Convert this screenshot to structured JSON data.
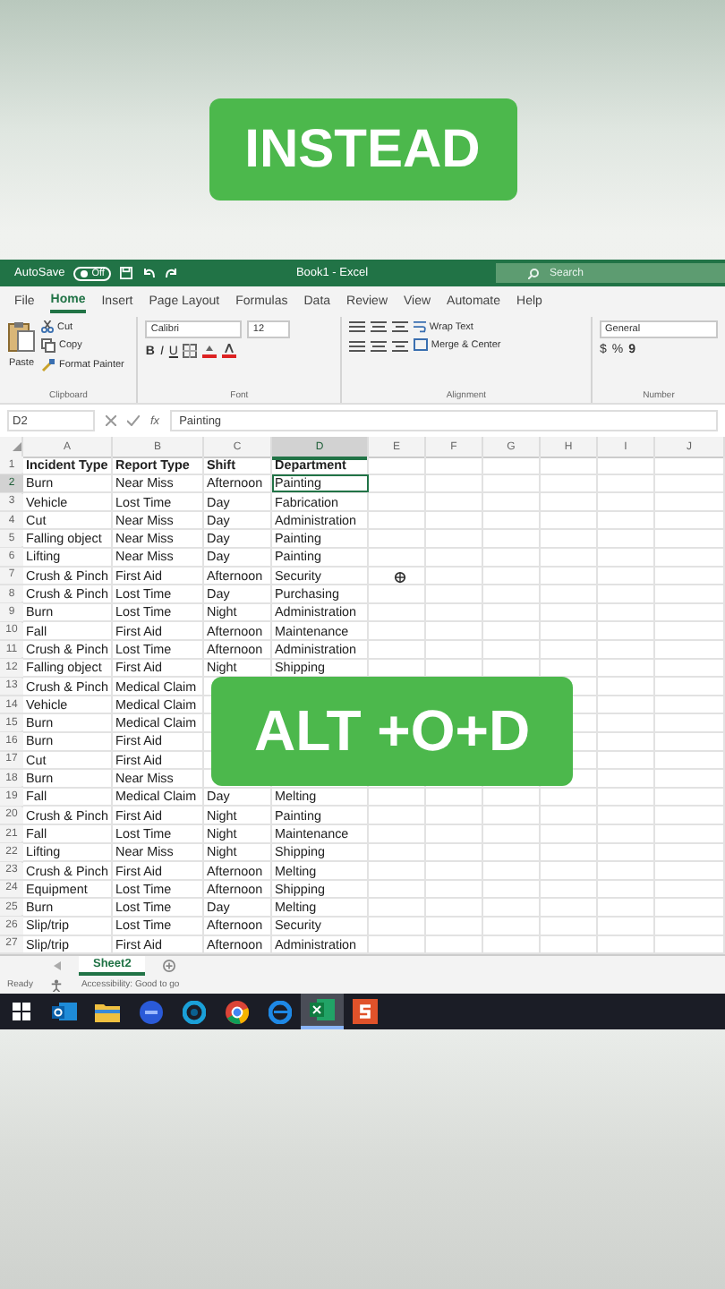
{
  "captions": [
    {
      "text": "INSTEAD"
    },
    {
      "text": "ALT +O+D"
    }
  ],
  "title_bar": {
    "autosave_label": "AutoSave",
    "autosave": {
      "label": "Off",
      "on": false
    },
    "title": "Book1 - Excel",
    "search": {
      "placeholder": "Search"
    }
  },
  "tabs": [
    {
      "label": "File",
      "selected": false
    },
    {
      "label": "Home",
      "selected": true
    },
    {
      "label": "Insert",
      "selected": false
    },
    {
      "label": "Page Layout",
      "selected": false
    },
    {
      "label": "Formulas",
      "selected": false
    },
    {
      "label": "Data",
      "selected": false
    },
    {
      "label": "Review",
      "selected": false
    },
    {
      "label": "View",
      "selected": false
    },
    {
      "label": "Automate",
      "selected": false
    },
    {
      "label": "Help",
      "selected": false
    }
  ],
  "ribbon": {
    "clipboard": {
      "paste": "Paste",
      "cut": "Cut",
      "copy": "Copy",
      "format_painter": "Format Painter",
      "label": "Clipboard"
    },
    "font": {
      "name": "Calibri",
      "size": "12",
      "bold": "B",
      "italic": "I",
      "underline": "U",
      "label": "Font"
    },
    "alignment": {
      "wrap": "Wrap Text",
      "merge": "Merge & Center",
      "label": "Alignment"
    },
    "number": {
      "format": "General",
      "currency": "$",
      "percent": "%",
      "comma": "9",
      "label": "Number"
    }
  },
  "formula_bar": {
    "name_box": "D2",
    "fx": "fx",
    "formula": "Painting"
  },
  "columns": [
    {
      "label": "A",
      "selected": false
    },
    {
      "label": "B",
      "selected": false
    },
    {
      "label": "C",
      "selected": false
    },
    {
      "label": "D",
      "selected": true
    },
    {
      "label": "E",
      "selected": false
    },
    {
      "label": "F",
      "selected": false
    },
    {
      "label": "G",
      "selected": false
    },
    {
      "label": "H",
      "selected": false
    },
    {
      "label": "I",
      "selected": false
    },
    {
      "label": "J",
      "selected": false
    }
  ],
  "rows": [
    {
      "num": "1",
      "kind": "header",
      "selected": false,
      "cells": [
        "Incident Type",
        "Report Type",
        "Shift",
        "Department"
      ]
    },
    {
      "num": "2",
      "kind": "data",
      "selected": true,
      "cells": [
        "Burn",
        "Near Miss",
        "Afternoon",
        "Painting"
      ]
    },
    {
      "num": "3",
      "kind": "data",
      "selected": false,
      "cells": [
        "Vehicle",
        "Lost Time",
        "Day",
        "Fabrication"
      ]
    },
    {
      "num": "4",
      "kind": "data",
      "selected": false,
      "cells": [
        "Cut",
        "Near Miss",
        "Day",
        "Administration"
      ]
    },
    {
      "num": "5",
      "kind": "data",
      "selected": false,
      "cells": [
        "Falling object",
        "Near Miss",
        "Day",
        "Painting"
      ]
    },
    {
      "num": "6",
      "kind": "data",
      "selected": false,
      "cells": [
        "Lifting",
        "Near Miss",
        "Day",
        "Painting"
      ]
    },
    {
      "num": "7",
      "kind": "data",
      "selected": false,
      "cells": [
        "Crush & Pinch",
        "First Aid",
        "Afternoon",
        "Security"
      ]
    },
    {
      "num": "8",
      "kind": "data",
      "selected": false,
      "cells": [
        "Crush & Pinch",
        "Lost Time",
        "Day",
        "Purchasing"
      ]
    },
    {
      "num": "9",
      "kind": "data",
      "selected": false,
      "cells": [
        "Burn",
        "Lost Time",
        "Night",
        "Administration"
      ]
    },
    {
      "num": "10",
      "kind": "data",
      "selected": false,
      "cells": [
        "Fall",
        "First Aid",
        "Afternoon",
        "Maintenance"
      ]
    },
    {
      "num": "11",
      "kind": "data",
      "selected": false,
      "cells": [
        "Crush & Pinch",
        "Lost Time",
        "Afternoon",
        "Administration"
      ]
    },
    {
      "num": "12",
      "kind": "data",
      "selected": false,
      "cells": [
        "Falling object",
        "First Aid",
        "Night",
        "Shipping"
      ]
    },
    {
      "num": "13",
      "kind": "data",
      "selected": false,
      "cells": [
        "Crush & Pinch",
        "Medical Claim"
      ]
    },
    {
      "num": "14",
      "kind": "data",
      "selected": false,
      "cells": [
        "Vehicle",
        "Medical Claim"
      ]
    },
    {
      "num": "15",
      "kind": "data",
      "selected": false,
      "cells": [
        "Burn",
        "Medical Claim"
      ]
    },
    {
      "num": "16",
      "kind": "data",
      "selected": false,
      "cells": [
        "Burn",
        "First Aid"
      ]
    },
    {
      "num": "17",
      "kind": "data",
      "selected": false,
      "cells": [
        "Cut",
        "First Aid"
      ]
    },
    {
      "num": "18",
      "kind": "data",
      "selected": false,
      "cells": [
        "Burn",
        "Near Miss"
      ]
    },
    {
      "num": "19",
      "kind": "data",
      "selected": false,
      "cells": [
        "Fall",
        "Medical Claim",
        "Day",
        "Melting"
      ]
    },
    {
      "num": "20",
      "kind": "data",
      "selected": false,
      "cells": [
        "Crush & Pinch",
        "First Aid",
        "Night",
        "Painting"
      ]
    },
    {
      "num": "21",
      "kind": "data",
      "selected": false,
      "cells": [
        "Fall",
        "Lost Time",
        "Night",
        "Maintenance"
      ]
    },
    {
      "num": "22",
      "kind": "data",
      "selected": false,
      "cells": [
        "Lifting",
        "Near Miss",
        "Night",
        "Shipping"
      ]
    },
    {
      "num": "23",
      "kind": "data",
      "selected": false,
      "cells": [
        "Crush & Pinch",
        "First Aid",
        "Afternoon",
        "Melting"
      ]
    },
    {
      "num": "24",
      "kind": "data",
      "selected": false,
      "cells": [
        "Equipment",
        "Lost Time",
        "Afternoon",
        "Shipping"
      ]
    },
    {
      "num": "25",
      "kind": "data",
      "selected": false,
      "cells": [
        "Burn",
        "Lost Time",
        "Day",
        "Melting"
      ]
    },
    {
      "num": "26",
      "kind": "data",
      "selected": false,
      "cells": [
        "Slip/trip",
        "Lost Time",
        "Afternoon",
        "Security"
      ]
    },
    {
      "num": "27",
      "kind": "data",
      "selected": false,
      "cells": [
        "Slip/trip",
        "First Aid",
        "Afternoon",
        "Administration"
      ]
    }
  ],
  "sheet_tabs": [
    {
      "label": "Sheet2",
      "selected": true
    }
  ],
  "status_bar": {
    "ready": "Ready",
    "accessibility": "Accessibility: Good to go"
  },
  "taskbar": [
    {
      "kind": "start",
      "active": false
    },
    {
      "kind": "mail",
      "active": false
    },
    {
      "kind": "folder",
      "active": false
    },
    {
      "kind": "round",
      "active": false
    },
    {
      "kind": "aperture",
      "active": false
    },
    {
      "kind": "chrome",
      "active": false
    },
    {
      "kind": "edge",
      "active": false
    },
    {
      "kind": "excel",
      "active": true
    },
    {
      "kind": "slides",
      "active": false
    }
  ]
}
